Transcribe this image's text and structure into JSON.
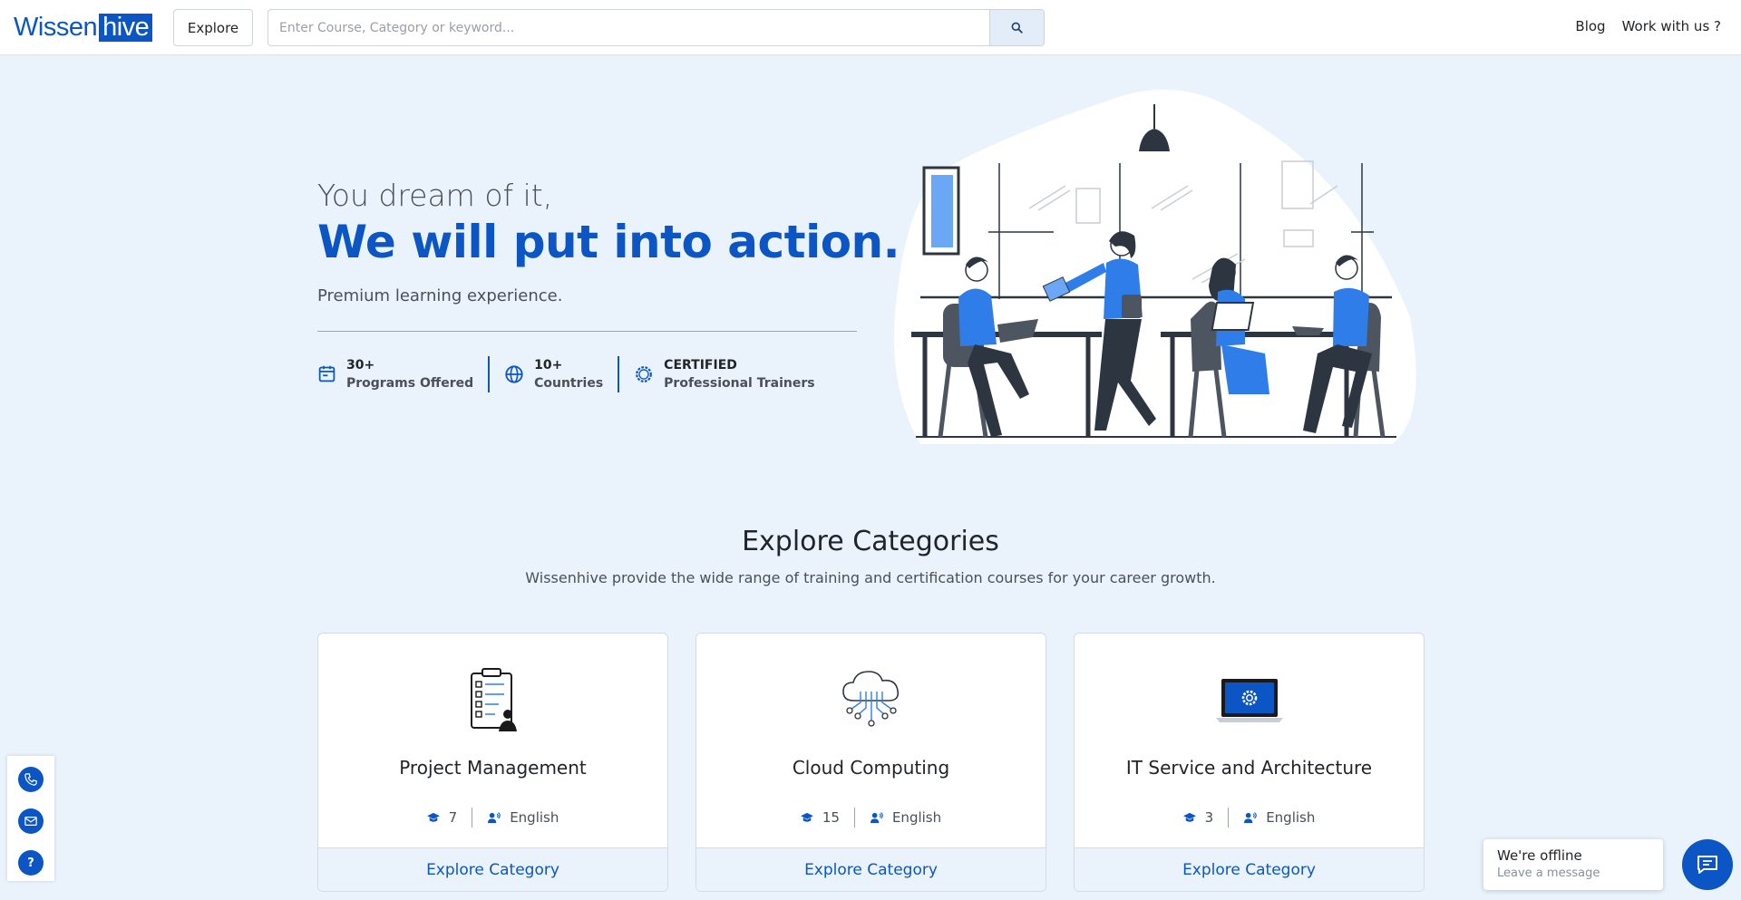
{
  "header": {
    "logo_part1": "Wissen",
    "logo_part2": "hive",
    "explore_label": "Explore",
    "search_placeholder": "Enter Course, Category or keyword...",
    "nav": [
      {
        "label": "Blog"
      },
      {
        "label": "Work with us ?"
      }
    ]
  },
  "hero": {
    "subtitle": "You dream of it,",
    "title": "We will put into action.",
    "tagline": "Premium learning experience.",
    "stats": [
      {
        "value": "30+",
        "label": "Programs Offered",
        "icon": "calendar-icon"
      },
      {
        "value": "10+",
        "label": "Countries",
        "icon": "globe-icon"
      },
      {
        "value": "CERTIFIED",
        "label": "Professional Trainers",
        "icon": "badge-icon"
      }
    ]
  },
  "categories": {
    "title": "Explore Categories",
    "description": "Wissenhive provide the wide range of training and certification courses for your career growth.",
    "items": [
      {
        "name": "Project Management",
        "count": "7",
        "language": "English",
        "cta": "Explore Category",
        "icon": "clipboard-checklist-icon"
      },
      {
        "name": "Cloud Computing",
        "count": "15",
        "language": "English",
        "cta": "Explore Category",
        "icon": "cloud-network-icon"
      },
      {
        "name": "IT Service and Architecture",
        "count": "3",
        "language": "English",
        "cta": "Explore Category",
        "icon": "laptop-gear-icon"
      }
    ]
  },
  "side_contact": {
    "help_label": "?"
  },
  "chat": {
    "status": "We're offline",
    "prompt": "Leave a message"
  },
  "colors": {
    "brand": "#0b56c4",
    "background": "#eaf3fc"
  }
}
